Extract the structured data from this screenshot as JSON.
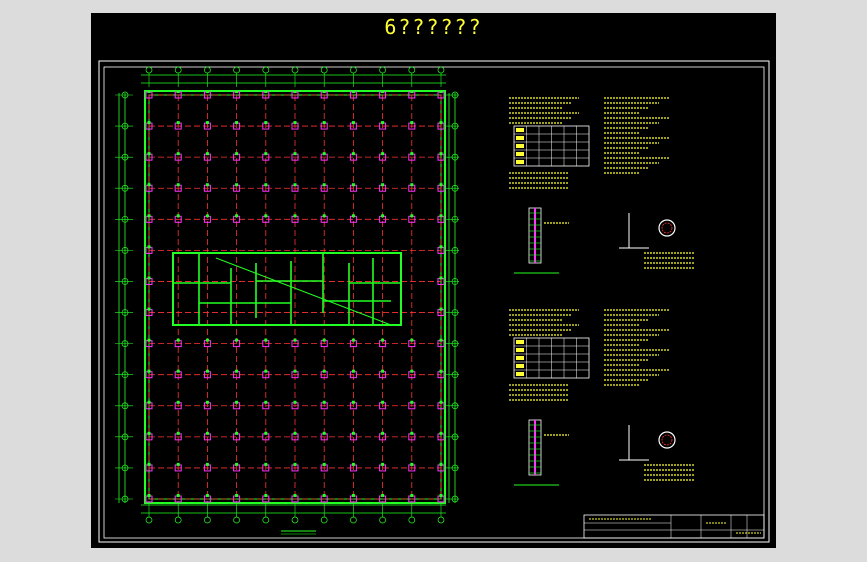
{
  "drawing": {
    "title": "6??????",
    "colors": {
      "background": "#000000",
      "frame": "#ffffff",
      "grid_axis": "#ff3333",
      "walls": "#22ff22",
      "text": "#ffff33",
      "columns": "#ff33ff"
    }
  }
}
